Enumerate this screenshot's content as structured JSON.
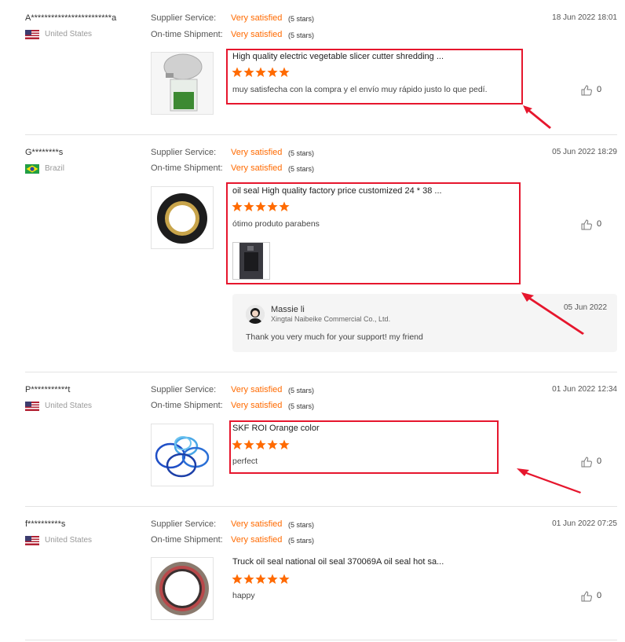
{
  "labels": {
    "supplier_service": "Supplier Service:",
    "ontime_shipment": "On-time Shipment:"
  },
  "colors": {
    "accent": "#ff6a00",
    "highlight_box": "#e6162d"
  },
  "reviews": [
    {
      "user": "A************************a",
      "country": "United States",
      "flag_icon": "us-flag-icon",
      "supplier_rating": "Very satisfied",
      "supplier_stars": "(5 stars)",
      "shipment_rating": "Very satisfied",
      "shipment_stars": "(5 stars)",
      "date": "18 Jun 2022 18:01",
      "product_title": "High quality electric vegetable slicer cutter shredding ...",
      "rating": 5,
      "comment": "muy satisfecha con la compra y el envío muy rápido justo lo que pedí.",
      "likes": "0"
    },
    {
      "user": "G********s",
      "country": "Brazil",
      "flag_icon": "brazil-flag-icon",
      "supplier_rating": "Very satisfied",
      "supplier_stars": "(5 stars)",
      "shipment_rating": "Very satisfied",
      "shipment_stars": "(5 stars)",
      "date": "05 Jun 2022 18:29",
      "product_title": "oil seal High quality factory price customized 24 * 38 ...",
      "rating": 5,
      "comment": "ótimo produto parabens",
      "likes": "0",
      "reply": {
        "name": "Massie li",
        "company": "Xingtai Naibeike Commercial Co., Ltd.",
        "date": "05 Jun 2022",
        "text": "Thank you very much for your support! my friend"
      }
    },
    {
      "user": "P***********t",
      "country": "United States",
      "flag_icon": "us-flag-icon",
      "supplier_rating": "Very satisfied",
      "supplier_stars": "(5 stars)",
      "shipment_rating": "Very satisfied",
      "shipment_stars": "(5 stars)",
      "date": "01 Jun 2022 12:34",
      "product_title": "SKF ROI Orange color",
      "rating": 5,
      "comment": "perfect",
      "likes": "0"
    },
    {
      "user": "f**********s",
      "country": "United States",
      "flag_icon": "us-flag-icon",
      "supplier_rating": "Very satisfied",
      "supplier_stars": "(5 stars)",
      "shipment_rating": "Very satisfied",
      "shipment_stars": "(5 stars)",
      "date": "01 Jun 2022 07:25",
      "product_title": "Truck oil seal national oil seal 370069A oil seal hot sa...",
      "rating": 5,
      "comment": "happy",
      "likes": "0"
    }
  ]
}
